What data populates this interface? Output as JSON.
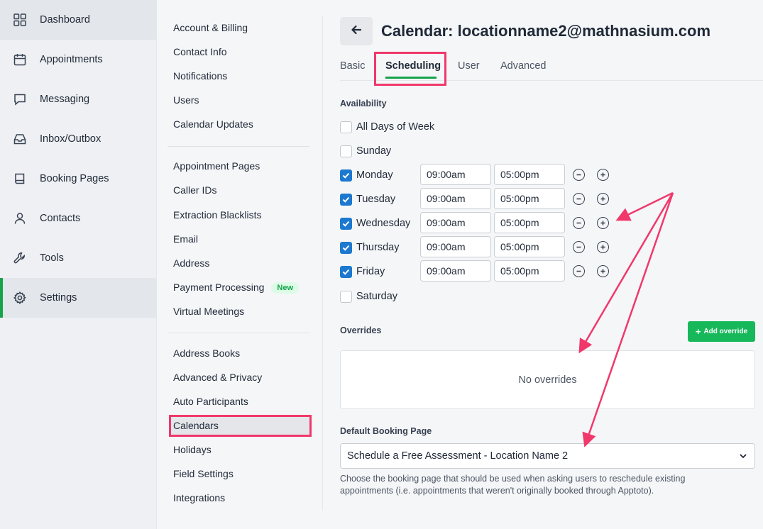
{
  "nav": [
    {
      "label": "Dashboard",
      "icon": "grid-icon"
    },
    {
      "label": "Appointments",
      "icon": "calendar-icon"
    },
    {
      "label": "Messaging",
      "icon": "chat-icon"
    },
    {
      "label": "Inbox/Outbox",
      "icon": "inbox-icon"
    },
    {
      "label": "Booking Pages",
      "icon": "book-icon"
    },
    {
      "label": "Contacts",
      "icon": "person-icon"
    },
    {
      "label": "Tools",
      "icon": "wrench-icon"
    },
    {
      "label": "Settings",
      "icon": "gear-icon"
    }
  ],
  "settings_menu": {
    "group1": [
      "Account & Billing",
      "Contact Info",
      "Notifications",
      "Users",
      "Calendar Updates"
    ],
    "group2": [
      "Appointment Pages",
      "Caller IDs",
      "Extraction Blacklists",
      "Email",
      "Address",
      "Payment Processing",
      "Virtual Meetings"
    ],
    "new_badge": "New",
    "group3": [
      "Address Books",
      "Advanced & Privacy",
      "Auto Participants",
      "Calendars",
      "Holidays",
      "Field Settings",
      "Integrations"
    ]
  },
  "header": {
    "title": "Calendar: locationname2@mathnasium.com"
  },
  "tabs": [
    "Basic",
    "Scheduling",
    "User",
    "Advanced"
  ],
  "availability": {
    "label": "Availability",
    "all_days_label": "All Days of Week",
    "days": [
      {
        "name": "Sunday",
        "checked": false
      },
      {
        "name": "Monday",
        "checked": true,
        "start": "09:00am",
        "end": "05:00pm"
      },
      {
        "name": "Tuesday",
        "checked": true,
        "start": "09:00am",
        "end": "05:00pm"
      },
      {
        "name": "Wednesday",
        "checked": true,
        "start": "09:00am",
        "end": "05:00pm"
      },
      {
        "name": "Thursday",
        "checked": true,
        "start": "09:00am",
        "end": "05:00pm"
      },
      {
        "name": "Friday",
        "checked": true,
        "start": "09:00am",
        "end": "05:00pm"
      },
      {
        "name": "Saturday",
        "checked": false
      }
    ]
  },
  "overrides": {
    "label": "Overrides",
    "add_button": "Add override",
    "empty_text": "No overrides"
  },
  "booking": {
    "label": "Default Booking Page",
    "selected": "Schedule a Free Assessment - Location Name 2",
    "help": "Choose the booking page that should be used when asking users to reschedule existing appointments (i.e. appointments that weren't originally booked through Apptoto)."
  },
  "colors": {
    "accent_green": "#16a34a",
    "highlight_pink": "#f0386b",
    "checkbox_blue": "#1d78d0"
  }
}
